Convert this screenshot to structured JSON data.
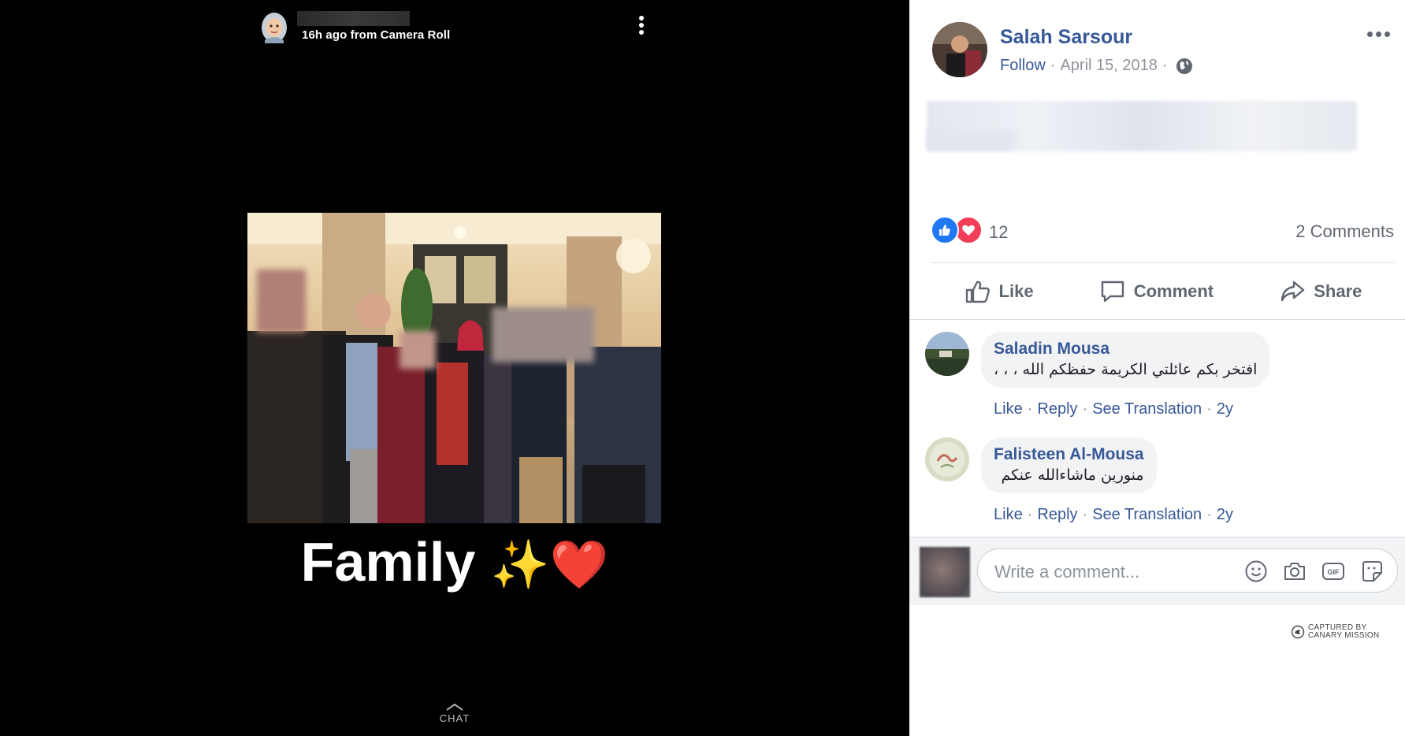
{
  "story": {
    "meta": "16h ago from Camera Roll",
    "caption": "Family",
    "caption_emoji_sparkles": "✨",
    "caption_emoji_heart": "❤️",
    "chat_label": "CHAT"
  },
  "post": {
    "author": "Salah Sarsour",
    "follow_label": "Follow",
    "separator": "·",
    "date": "April 15, 2018",
    "reaction_count": "12",
    "comments_count": "2 Comments",
    "actions": {
      "like": "Like",
      "comment": "Comment",
      "share": "Share"
    }
  },
  "comments": [
    {
      "author": "Saladin Mousa",
      "text": "افتخر بكم عائلتي الكريمة حفظكم الله ، ، ،",
      "like": "Like",
      "reply": "Reply",
      "see_translation": "See Translation",
      "age": "2y"
    },
    {
      "author": "Falisteen Al-Mousa",
      "text": "منورين ماشاءالله عنكم",
      "like": "Like",
      "reply": "Reply",
      "see_translation": "See Translation",
      "age": "2y"
    }
  ],
  "composer": {
    "placeholder": "Write a comment..."
  },
  "watermark": {
    "line1": "CAPTURED BY",
    "line2": "CANARY MISSION"
  },
  "colors": {
    "fb_link": "#365899",
    "fb_gray": "#606770",
    "like_blue": "#2078f4",
    "love_red": "#f33e58"
  },
  "icons": [
    "bitmoji-avatar",
    "vertical-dots-icon",
    "chevron-up-icon",
    "globe-icon",
    "more-dots-icon",
    "like-reaction-icon",
    "love-reaction-icon",
    "thumbs-up-icon",
    "comment-icon",
    "share-icon",
    "emoji-icon",
    "camera-icon",
    "gif-icon",
    "sticker-icon",
    "canary-logo-icon"
  ]
}
